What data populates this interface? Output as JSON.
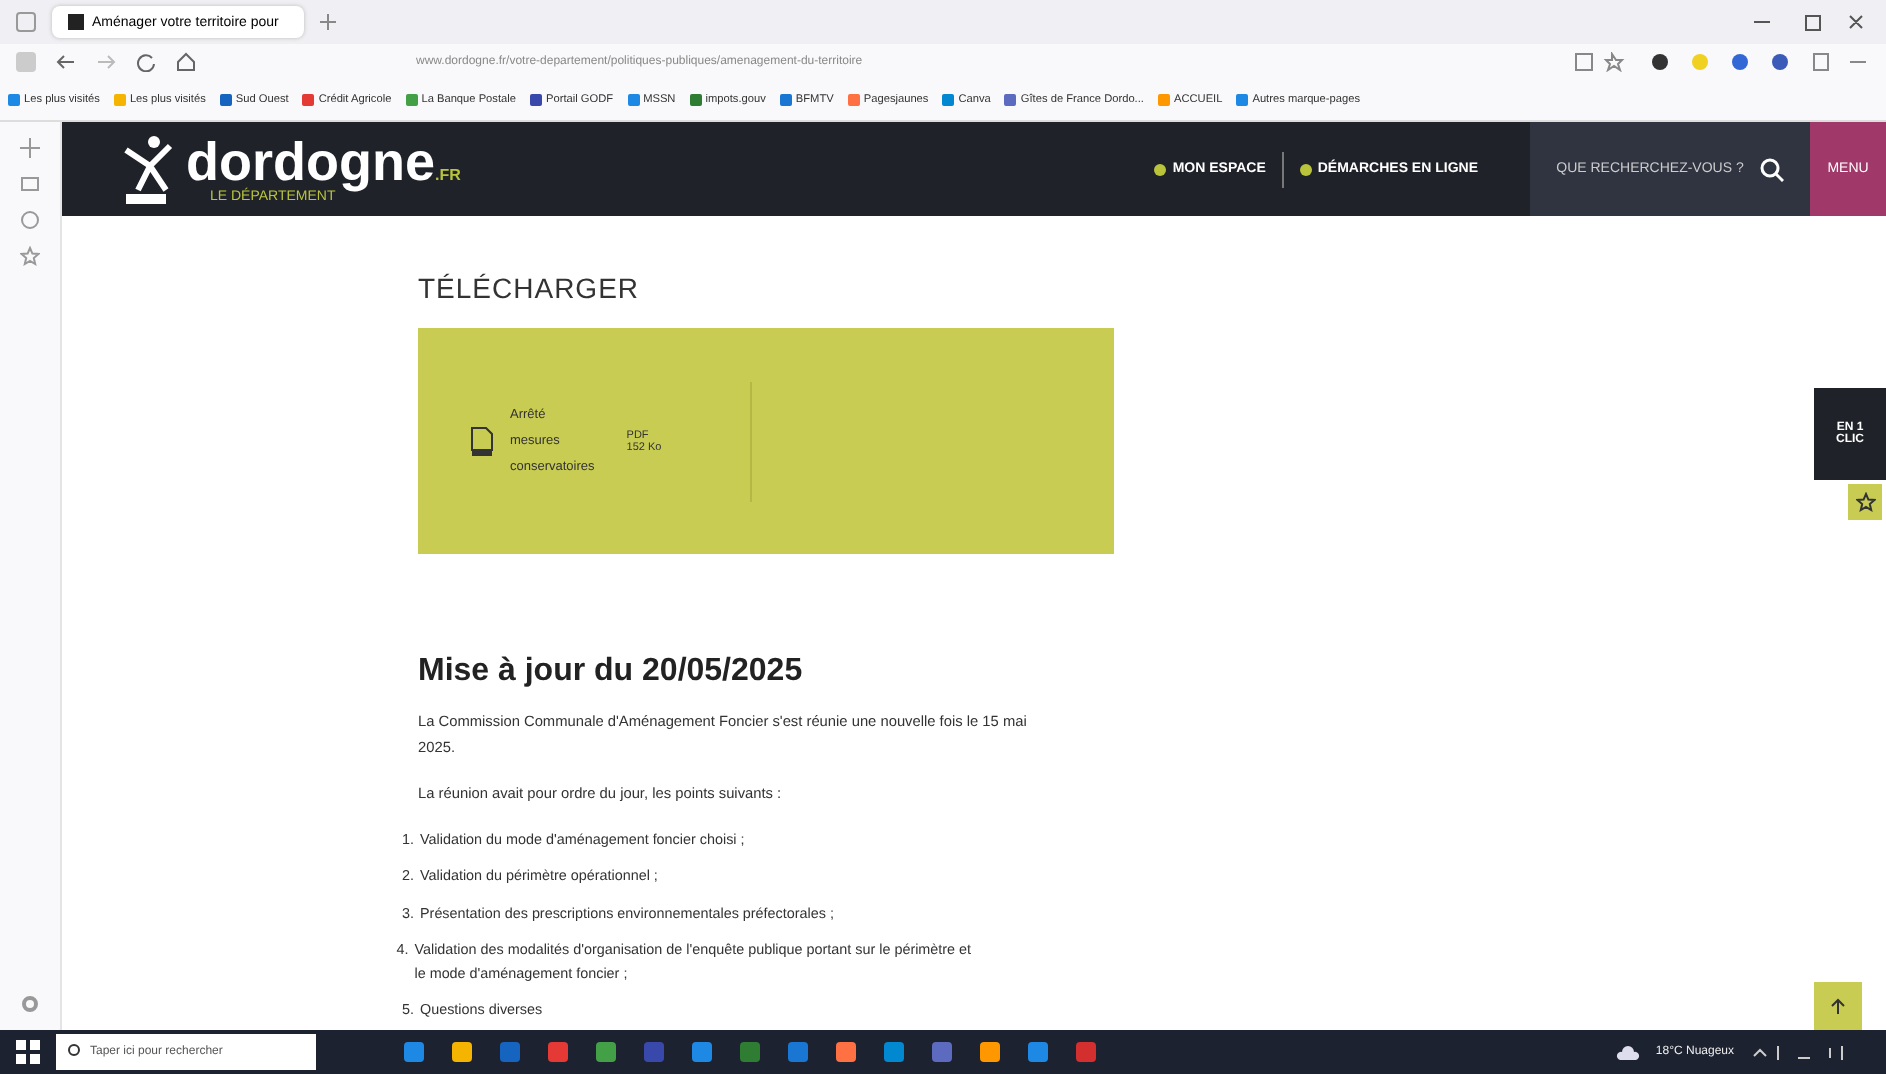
{
  "browser": {
    "tab_title": "Aménager votre territoire pour",
    "url": "www.dordogne.fr/votre-departement/politiques-publiques/amenagement-du-territoire",
    "bookmarks": [
      "Les plus visités",
      "Les plus visités",
      "Sud Ouest",
      "Crédit Agricole",
      "La Banque Postale",
      "Portail GODF",
      "MSSN",
      "impots.gouv",
      "BFMTV",
      "Pagesjaunes",
      "Canva",
      "Gîtes de France Dordo...",
      "ACCUEIL",
      "Autres marque-pages"
    ]
  },
  "header": {
    "logo": "dordogne",
    "logo_suffix": ".FR",
    "subtitle": "LE DÉPARTEMENT",
    "links": [
      "MON ESPACE",
      "DÉMARCHES EN LIGNE"
    ],
    "search_placeholder": "QUE RECHERCHEZ-VOUS ?",
    "menu": "MENU"
  },
  "download": {
    "title": "TÉLÉCHARGER",
    "file_lines": [
      "Arrêté",
      "mesures",
      "conservatoires"
    ],
    "file_type": "PDF",
    "file_size": "152 Ko"
  },
  "side_tab": "EN 1 CLIC",
  "article": {
    "heading": "Mise à jour du 20/05/2025",
    "paragraphs": [
      "La Commission Communale d'Aménagement Foncier s'est réunie une nouvelle fois le 15 mai 2025.",
      "La réunion avait pour ordre du jour, les points suivants :"
    ],
    "items": [
      {
        "num": "1.",
        "text": "Validation du mode d'aménagement foncier choisi ;"
      },
      {
        "num": "2.",
        "text": "Validation du périmètre opérationnel ;"
      },
      {
        "num": "3.",
        "text": "Présentation des prescriptions environnementales préfectorales ;"
      },
      {
        "num": "4.",
        "text": "Validation des modalités d'organisation de l'enquête publique portant sur le périmètre et le mode d'aménagement foncier ;"
      },
      {
        "num": "5.",
        "text": "Questions diverses"
      }
    ]
  },
  "taskbar": {
    "search_placeholder": "Taper ici pour rechercher",
    "weather": "18°C Nuageux"
  }
}
